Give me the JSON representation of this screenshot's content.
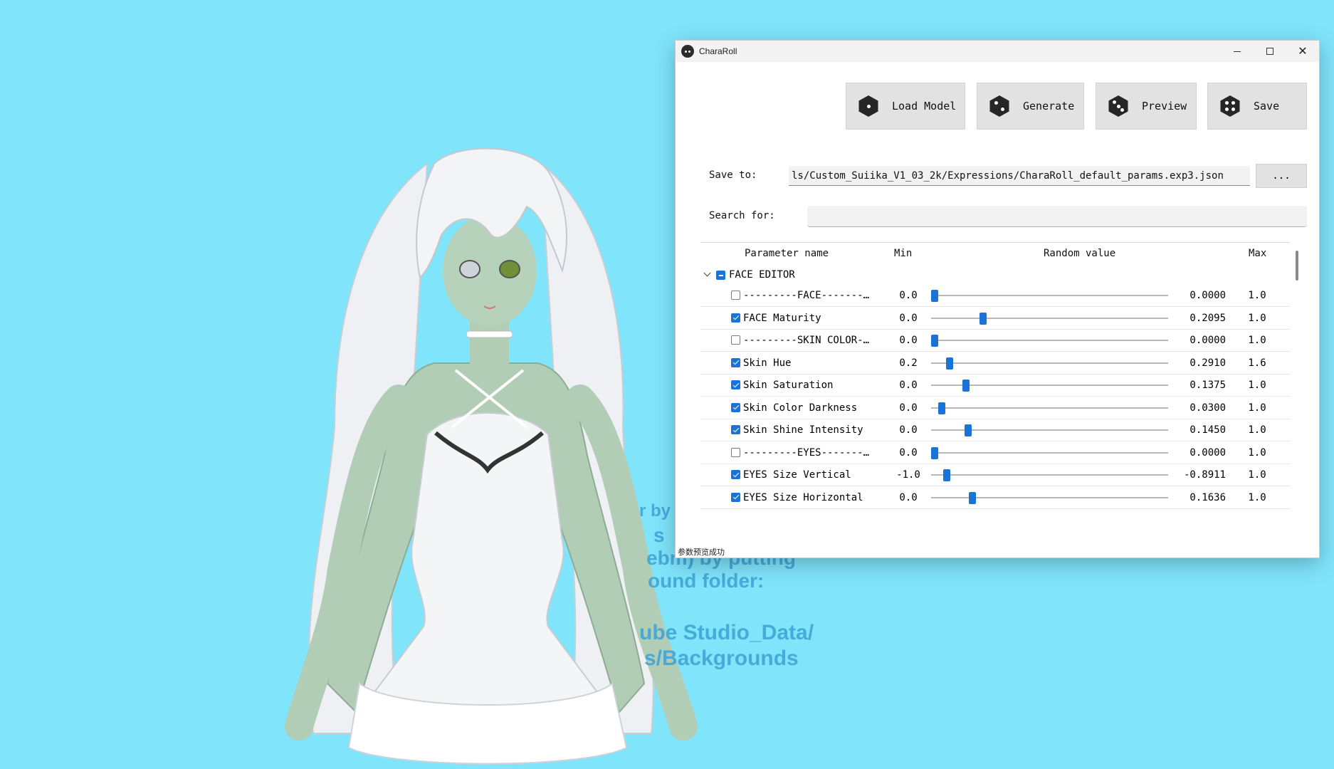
{
  "background": {
    "color": "#80e4fb",
    "hint_lines": [
      "r by",
      "s",
      "ebm) by putting",
      "ound folder:",
      "ube Studio_Data/",
      "s/Backgrounds"
    ]
  },
  "window": {
    "title": "CharaRoll",
    "controls": {
      "minimize": "—",
      "maximize": "☐",
      "close": "✕"
    }
  },
  "toolbar": {
    "load_model": "Load Model",
    "generate": "Generate",
    "preview": "Preview",
    "save": "Save"
  },
  "save_to": {
    "label": "Save to:",
    "path": "ls/Custom_Suiika_V1_03_2k/Expressions/CharaRoll_default_params.exp3.json",
    "browse_label": "..."
  },
  "search": {
    "label": "Search for:",
    "value": "",
    "placeholder": ""
  },
  "table": {
    "headers": {
      "name": "Parameter name",
      "min": "Min",
      "random": "Random value",
      "max": "Max"
    },
    "group": {
      "name": "FACE EDITOR",
      "state": "partial",
      "expanded": true
    },
    "rows": [
      {
        "name": "---------FACE------------",
        "checked": false,
        "min": "0.0",
        "value": "0.0000",
        "max": "1.0",
        "fraction": 0.0
      },
      {
        "name": "FACE Maturity",
        "checked": true,
        "min": "0.0",
        "value": "0.2095",
        "max": "1.0",
        "fraction": 0.2095
      },
      {
        "name": "---------SKIN COLOR------",
        "checked": false,
        "min": "0.0",
        "value": "0.0000",
        "max": "1.0",
        "fraction": 0.0
      },
      {
        "name": "Skin Hue",
        "checked": true,
        "min": "0.2",
        "value": "0.2910",
        "max": "1.6",
        "fraction": 0.065
      },
      {
        "name": "Skin Saturation",
        "checked": true,
        "min": "0.0",
        "value": "0.1375",
        "max": "1.0",
        "fraction": 0.1375
      },
      {
        "name": "Skin Color Darkness",
        "checked": true,
        "min": "0.0",
        "value": "0.0300",
        "max": "1.0",
        "fraction": 0.03
      },
      {
        "name": "Skin Shine Intensity",
        "checked": true,
        "min": "0.0",
        "value": "0.1450",
        "max": "1.0",
        "fraction": 0.145
      },
      {
        "name": "---------EYES------------",
        "checked": false,
        "min": "0.0",
        "value": "0.0000",
        "max": "1.0",
        "fraction": 0.0
      },
      {
        "name": "EYES Size Vertical",
        "checked": true,
        "min": "-1.0",
        "value": "-0.8911",
        "max": "1.0",
        "fraction": 0.054
      },
      {
        "name": "EYES Size Horizontal",
        "checked": true,
        "min": "0.0",
        "value": "0.1636",
        "max": "1.0",
        "fraction": 0.1636
      }
    ]
  },
  "status_text": "参数预览成功",
  "colors": {
    "accent": "#1a73d6",
    "button_bg": "#e2e2e2"
  }
}
